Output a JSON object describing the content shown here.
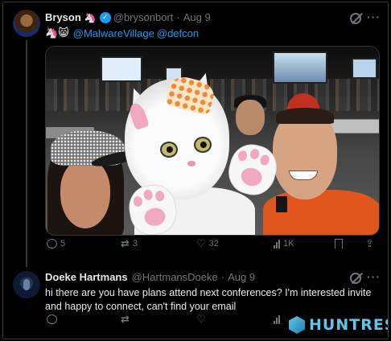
{
  "tweet": {
    "author": "Bryson",
    "author_emoji": "🦄",
    "handle": "@brysonbort",
    "time": "Aug 9",
    "line_emojis": "🦄😸",
    "mentions": [
      "@MalwareVillage",
      "@defcon"
    ],
    "stats": {
      "replies": "5",
      "reposts": "3",
      "likes": "32",
      "views": "1K"
    }
  },
  "reply": {
    "author": "Doeke Hartmans",
    "handle": "@HartmansDoeke",
    "time": "Aug 9",
    "text": "hi there are you have plans attend next conferences? I'm interested invite and happy to connect, can't find your email",
    "stats": {
      "replies": "",
      "reposts": "",
      "likes": "",
      "views": ""
    }
  },
  "dot": "·",
  "more": "···",
  "watermark": "HUNTRESS",
  "icons": {
    "reply": "reply-icon",
    "repost": "repost-icon",
    "like": "heart-icon",
    "views": "views-icon",
    "bookmark": "bookmark-icon",
    "share": "share-icon",
    "verified": "verified-badge-icon",
    "grok": "grok-icon",
    "more": "more-icon"
  },
  "colors": {
    "accent": "#1d9bf0",
    "muted": "#71767b",
    "background": "#000000",
    "text": "#e7e9ea",
    "watermark": "#5ec6e8"
  }
}
